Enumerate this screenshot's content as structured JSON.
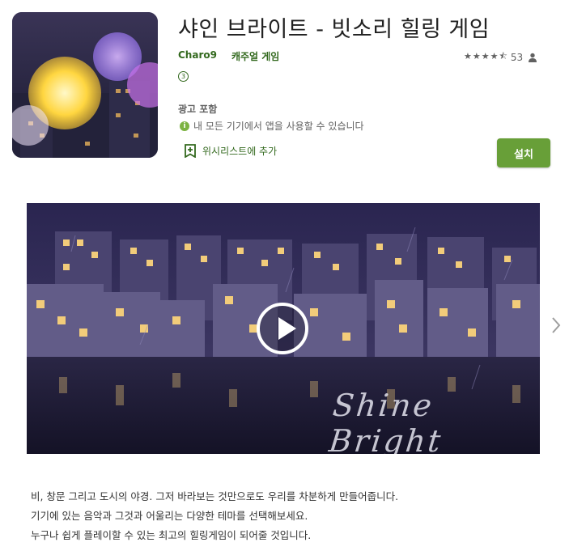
{
  "app": {
    "title": "샤인 브라이트 - 빗소리 힐링 게임",
    "developer": "Charo9",
    "category": "캐주얼 게임",
    "rating_value": 4.5,
    "rating_count": "53",
    "content_rating": "3",
    "ads_label": "광고 포함",
    "compat_text": "내 모든 기기에서 앱을 사용할 수 있습니다",
    "wishlist_label": "위시리스트에 추가",
    "install_label": "설치"
  },
  "video": {
    "watermark": "Shine Bright"
  },
  "description": [
    "비, 창문 그리고 도시의 야경. 그저 바라보는 것만으로도 우리를 차분하게 만들어줍니다.",
    "기기에 있는 음악과 그것과 어울리는 다양한 테마를 선택해보세요.",
    "누구나 쉽게 플레이할 수 있는 최고의 힐링게임이 되어줄 것입니다."
  ],
  "icons": {
    "rating_star": "star-icon",
    "reviewer": "person-icon",
    "info": "info-icon",
    "wishlist": "bookmark-add-icon",
    "play": "play-icon",
    "next": "chevron-right-icon"
  },
  "colors": {
    "accent_green": "#689f38",
    "dark_green_text": "#33691e",
    "info_green": "#7cb342"
  }
}
